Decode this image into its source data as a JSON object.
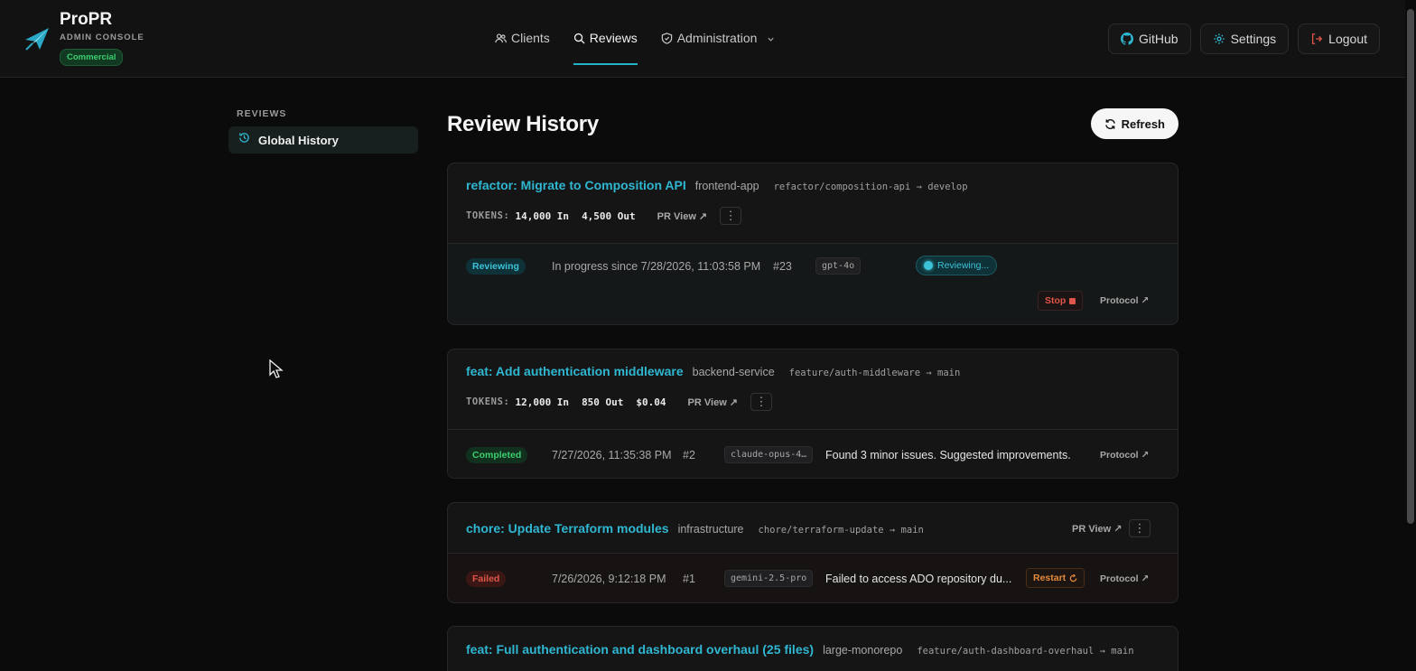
{
  "brand": {
    "name": "ProPR",
    "subtitle": "ADMIN CONSOLE",
    "badge": "Commercial"
  },
  "nav": {
    "clients": "Clients",
    "reviews": "Reviews",
    "administration": "Administration"
  },
  "actions": {
    "github": "GitHub",
    "settings": "Settings",
    "logout": "Logout"
  },
  "sidebar": {
    "heading": "REVIEWS",
    "items": [
      {
        "label": "Global History"
      }
    ]
  },
  "main": {
    "title": "Review History",
    "refresh": "Refresh"
  },
  "cards": [
    {
      "title": "refactor: Migrate to Composition API",
      "repo": "frontend-app",
      "branch": "refactor/composition-api → develop",
      "tokens_label": "TOKENS:",
      "tokens_in": "14,000 In",
      "tokens_out": "4,500 Out",
      "pr_view": "PR View ↗",
      "status": "Reviewing",
      "time": "In progress since 7/28/2026, 11:03:58 PM",
      "number": "#23",
      "model": "gpt-4o",
      "live": "Reviewing...",
      "stop": "Stop",
      "protocol": "Protocol ↗"
    },
    {
      "title": "feat: Add authentication middleware",
      "repo": "backend-service",
      "branch": "feature/auth-middleware → main",
      "tokens_label": "TOKENS:",
      "tokens_in": "12,000 In",
      "tokens_out": "850 Out",
      "cost": "$0.04",
      "pr_view": "PR View ↗",
      "status": "Completed",
      "time": "7/27/2026, 11:35:38 PM",
      "number": "#2",
      "model": "claude-opus-4…",
      "summary": "Found 3 minor issues. Suggested improvements.",
      "protocol": "Protocol ↗"
    },
    {
      "title": "chore: Update Terraform modules",
      "repo": "infrastructure",
      "branch": "chore/terraform-update → main",
      "pr_view": "PR View ↗",
      "status": "Failed",
      "time": "7/26/2026, 9:12:18 PM",
      "number": "#1",
      "model": "gemini-2.5-pro",
      "summary": "Failed to access ADO repository du...",
      "restart": "Restart",
      "protocol": "Protocol ↗"
    },
    {
      "title": "feat: Full authentication and dashboard overhaul (25 files)",
      "repo": "large-monorepo",
      "branch": "feature/auth-dashboard-overhaul → main"
    }
  ],
  "colors": {
    "accent": "#22b3c9",
    "success": "#3ccf6e",
    "danger": "#e0554a",
    "warning": "#e58a3a"
  }
}
